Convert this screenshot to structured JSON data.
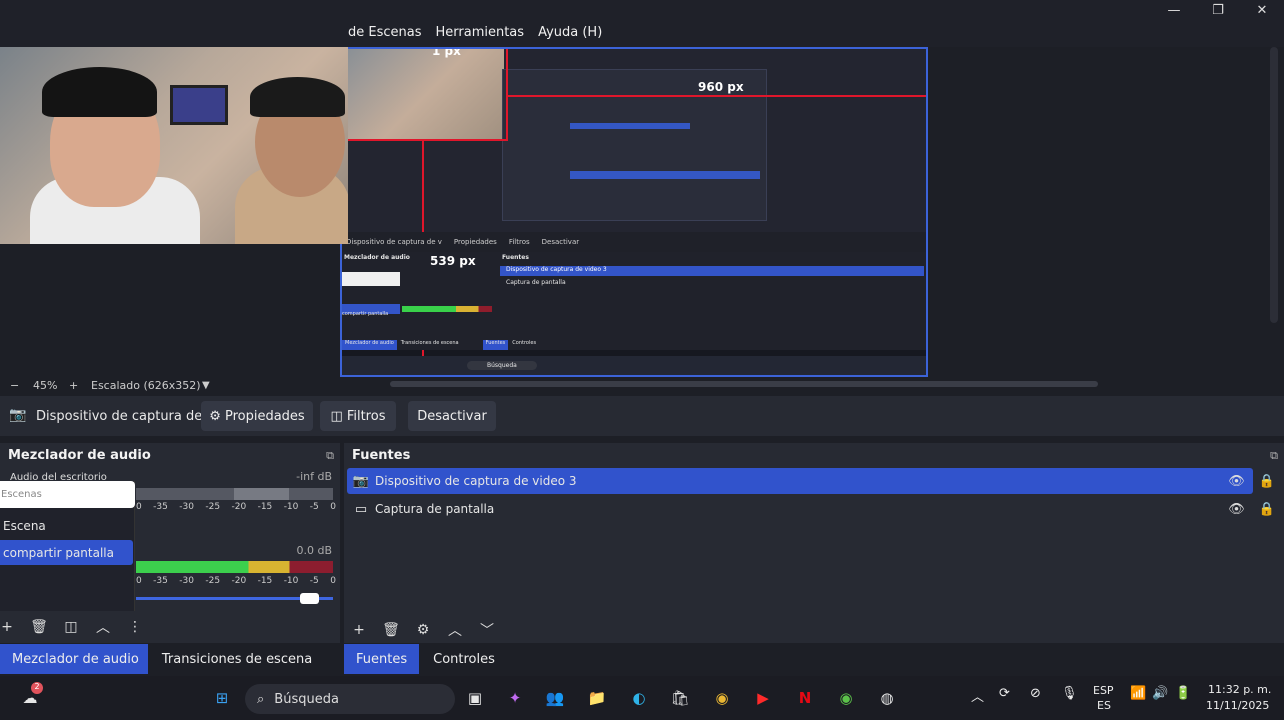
{
  "menubar": {
    "items": [
      "de Escenas",
      "Herramientas",
      "Ayuda (H)"
    ]
  },
  "window_controls": {
    "minimize": "—",
    "restore": "❐",
    "close": "✕"
  },
  "preview": {
    "labels": {
      "top_px": "1 px",
      "width_px": "960 px",
      "height_px": "539 px"
    },
    "inner_toolbar": [
      "Dispositivo de captura de v",
      "Propiedades",
      "Filtros",
      "Desactivar"
    ],
    "inner_panels": {
      "mixer_title": "Mezclador de audio",
      "sources_title": "Fuentes",
      "source_1": "Dispositivo de captura de video 3",
      "source_2": "Captura de pantalla",
      "scene_selected": "compartir pantalla",
      "tab_mixer": "Mezclador de audio",
      "tab_transitions": "Transiciones de escena",
      "tab_sources": "Fuentes",
      "tab_controls": "Controles",
      "search": "Búsqueda"
    }
  },
  "zoombar": {
    "minus": "−",
    "zoom": "45%",
    "plus": "+",
    "scaling": "Escalado (626x352)",
    "dropdown": "▼"
  },
  "source_toolbar": {
    "source_name": "Dispositivo de captura de v",
    "properties": "Propiedades",
    "filters": "Filtros",
    "deactivate": "Desactivar"
  },
  "mixer": {
    "title": "Mezclador de audio",
    "channel_1": {
      "label": "Audio del escritorio",
      "db": "-inf dB"
    },
    "channel_2": {
      "db": "0.0 dB"
    },
    "ticks": [
      "0",
      "-35",
      "-30",
      "-25",
      "-20",
      "-15",
      "-10",
      "-5",
      "0"
    ],
    "volume_level": 0.92
  },
  "scenes_popup": {
    "header": "Escenas",
    "items": [
      "Escena",
      "compartir pantalla"
    ],
    "selected": "compartir pantalla"
  },
  "sources": {
    "title": "Fuentes",
    "items": [
      {
        "label": "Dispositivo de captura de video 3",
        "icon": "camera-icon",
        "selected": true
      },
      {
        "label": "Captura de pantalla",
        "icon": "monitor-icon",
        "selected": false
      }
    ]
  },
  "tabs_left": {
    "mixer": "Mezclador de audio",
    "transitions": "Transiciones de escena"
  },
  "tabs_right": {
    "sources": "Fuentes",
    "controls": "Controles"
  },
  "taskbar": {
    "search": "Búsqueda",
    "weather_badge": "2",
    "lang_top": "ESP",
    "lang_bottom": "ES",
    "time": "11:32 p. m.",
    "date": "11/11/2025"
  },
  "colors": {
    "accent": "#3153cc",
    "guide_red": "#e0162b",
    "panel": "#272a33",
    "background": "#1d1f26"
  }
}
